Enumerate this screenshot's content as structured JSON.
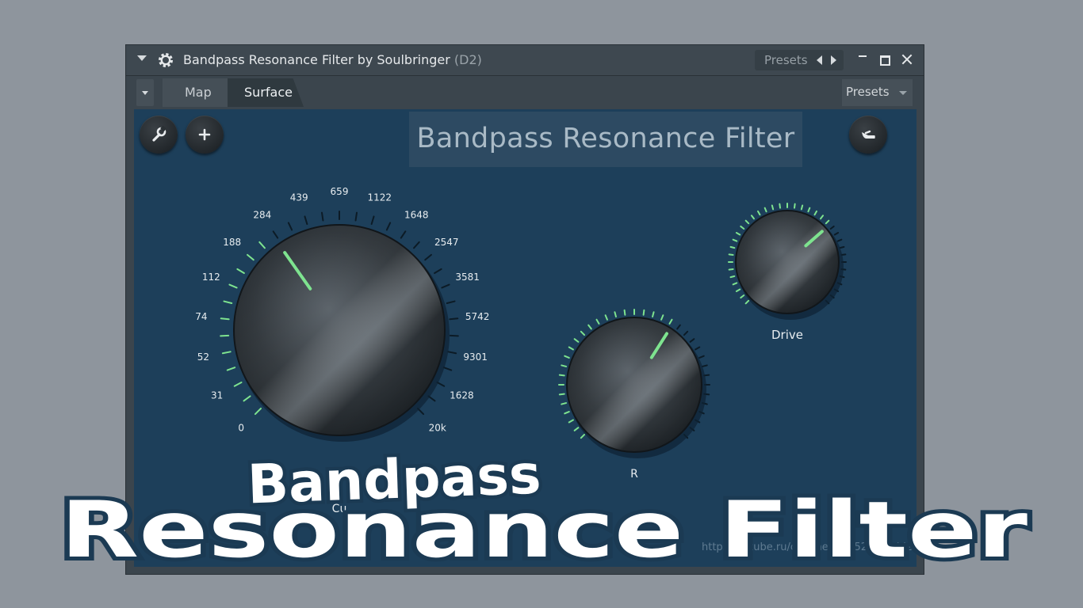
{
  "window": {
    "title": "Bandpass Resonance Filter by Soulbringer",
    "title_suffix": "(D2)",
    "presets_label": "Presets"
  },
  "tabs": {
    "map": "Map",
    "surface": "Surface",
    "presets": "Presets"
  },
  "surface": {
    "title": "Bandpass Resonance Filter",
    "buttons": [
      "wrench-icon",
      "plus-icon",
      "hand-icon"
    ],
    "url": "https://rutube.ru/channel/47652812/videos/",
    "accent_color": "#7ee38f",
    "knobs": {
      "cutoff": {
        "label": "Cu",
        "scale": [
          "0",
          "31",
          "52",
          "74",
          "112",
          "188",
          "284",
          "439",
          "659",
          "1122",
          "1648",
          "2547",
          "3581",
          "5742",
          "9301",
          "1628",
          "20k"
        ],
        "value_fraction": 0.37
      },
      "resonance": {
        "label": "R",
        "value_fraction": 0.62
      },
      "drive": {
        "label": "Drive",
        "value_fraction": 0.68
      }
    }
  },
  "overlay": {
    "line1": "Bandpass",
    "line2": "Resonance Filter"
  }
}
